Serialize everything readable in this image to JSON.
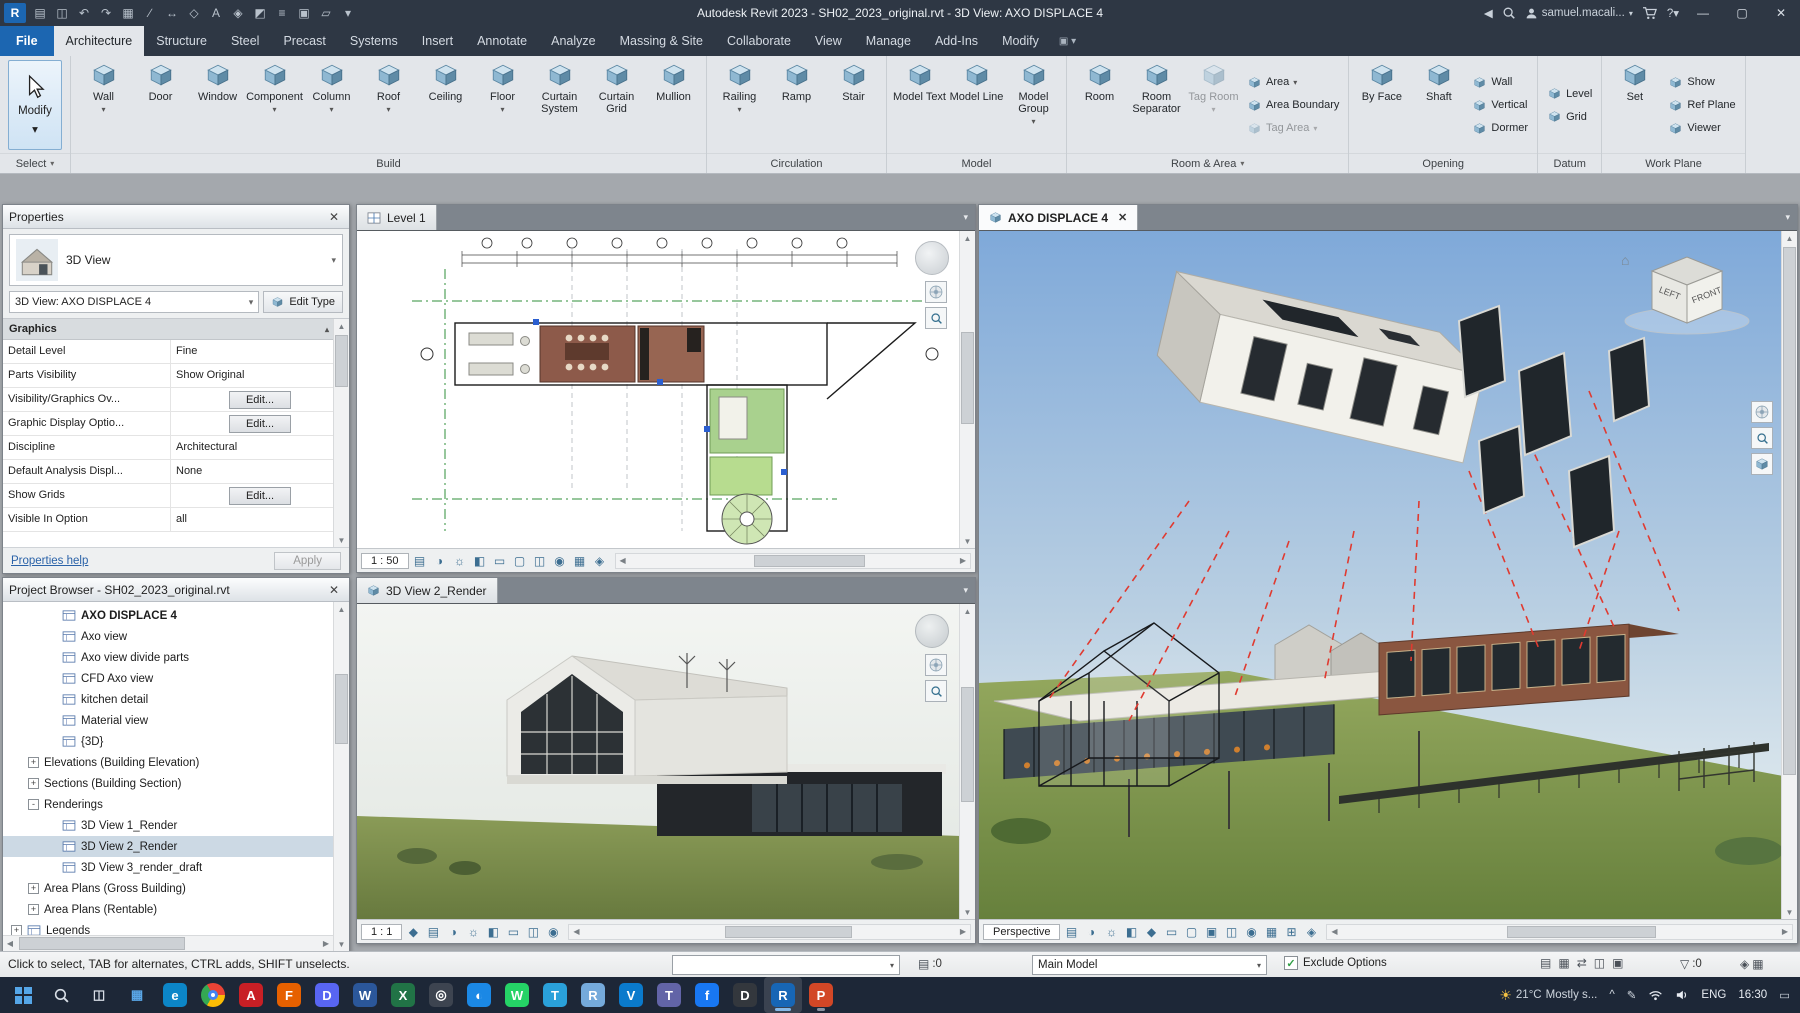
{
  "titlebar": {
    "title": "Autodesk Revit 2023 - SH02_2023_original.rvt - 3D View: AXO DISPLACE 4",
    "user_name": "samuel.macali...",
    "qat": [
      {
        "name": "revit-app-icon",
        "glyph": "R"
      },
      {
        "name": "open-icon",
        "glyph": "▤"
      },
      {
        "name": "save-icon",
        "glyph": "◫"
      },
      {
        "name": "undo-icon",
        "glyph": "↶"
      },
      {
        "name": "redo-icon",
        "glyph": "↷"
      },
      {
        "name": "print-icon",
        "glyph": "▦"
      },
      {
        "name": "measure-icon",
        "glyph": "∕"
      },
      {
        "name": "aligned-dimension-icon",
        "glyph": "↔"
      },
      {
        "name": "tag-by-category-icon",
        "glyph": "◇"
      },
      {
        "name": "text-icon",
        "glyph": "A"
      },
      {
        "name": "default-3d-view-icon",
        "glyph": "◈"
      },
      {
        "name": "section-icon",
        "glyph": "◩"
      },
      {
        "name": "thin-lines-icon",
        "glyph": "≡"
      },
      {
        "name": "close-hidden-windows-icon",
        "glyph": "▣"
      },
      {
        "name": "switch-windows-icon",
        "glyph": "▱"
      },
      {
        "name": "customize-qat-icon",
        "glyph": "▾"
      }
    ]
  },
  "ribbon": {
    "file_tab": "File",
    "tabs": [
      "Architecture",
      "Structure",
      "Steel",
      "Precast",
      "Systems",
      "Insert",
      "Annotate",
      "Analyze",
      "Massing & Site",
      "Collaborate",
      "View",
      "Manage",
      "Add-Ins",
      "Modify"
    ],
    "active_tab": "Architecture",
    "modify_button": "Modify",
    "panels": [
      {
        "label": "Select",
        "arrow": true,
        "groups": [
          {
            "type": "modify"
          }
        ]
      },
      {
        "label": "Build",
        "groups": [
          {
            "type": "big",
            "items": [
              {
                "label": "Wall",
                "arrow": true
              },
              {
                "label": "Door"
              },
              {
                "label": "Window"
              },
              {
                "label": "Component",
                "arrow": true
              },
              {
                "label": "Column",
                "arrow": true
              },
              {
                "label": "Roof",
                "arrow": true
              },
              {
                "label": "Ceiling"
              },
              {
                "label": "Floor",
                "arrow": true
              },
              {
                "label": "Curtain System"
              },
              {
                "label": "Curtain Grid"
              },
              {
                "label": "Mullion"
              }
            ]
          }
        ]
      },
      {
        "label": "Circulation",
        "groups": [
          {
            "type": "big",
            "items": [
              {
                "label": "Railing",
                "arrow": true
              },
              {
                "label": "Ramp"
              },
              {
                "label": "Stair"
              }
            ]
          }
        ]
      },
      {
        "label": "Model",
        "groups": [
          {
            "type": "big",
            "items": [
              {
                "label": "Model Text"
              },
              {
                "label": "Model Line"
              },
              {
                "label": "Model Group",
                "arrow": true
              }
            ]
          }
        ]
      },
      {
        "label": "Room & Area",
        "arrow": true,
        "groups": [
          {
            "type": "big",
            "items": [
              {
                "label": "Room"
              },
              {
                "label": "Room Separator"
              },
              {
                "label": "Tag Room",
                "arrow": true,
                "disabled": true
              }
            ]
          },
          {
            "type": "stack",
            "items": [
              {
                "label": "Area",
                "arrow": true
              },
              {
                "label": "Area Boundary"
              },
              {
                "label": "Tag Area",
                "arrow": true,
                "disabled": true
              }
            ]
          }
        ]
      },
      {
        "label": "Opening",
        "groups": [
          {
            "type": "big",
            "items": [
              {
                "label": "By Face"
              },
              {
                "label": "Shaft"
              }
            ]
          },
          {
            "type": "stack",
            "items": [
              {
                "label": "Wall"
              },
              {
                "label": "Vertical"
              },
              {
                "label": "Dormer"
              }
            ]
          }
        ]
      },
      {
        "label": "Datum",
        "groups": [
          {
            "type": "stack",
            "items": [
              {
                "label": "Level"
              },
              {
                "label": "Grid"
              }
            ]
          }
        ]
      },
      {
        "label": "Work Plane",
        "groups": [
          {
            "type": "big",
            "items": [
              {
                "label": "Set"
              }
            ]
          },
          {
            "type": "stack",
            "items": [
              {
                "label": "Show"
              },
              {
                "label": "Ref Plane"
              },
              {
                "label": "Viewer"
              }
            ]
          }
        ]
      }
    ]
  },
  "properties": {
    "title": "Properties",
    "type_label": "3D View",
    "instance_label": "3D View: AXO DISPLACE 4",
    "edit_type_label": "Edit Type",
    "section_label": "Graphics",
    "rows": [
      {
        "label": "Detail Level",
        "value": "Fine"
      },
      {
        "label": "Parts Visibility",
        "value": "Show Original"
      },
      {
        "label": "Visibility/Graphics Ov...",
        "value": "Edit...",
        "kind": "button"
      },
      {
        "label": "Graphic Display Optio...",
        "value": "Edit...",
        "kind": "button"
      },
      {
        "label": "Discipline",
        "value": "Architectural"
      },
      {
        "label": "Default Analysis Displ...",
        "value": "None"
      },
      {
        "label": "Show Grids",
        "value": "Edit...",
        "kind": "button"
      },
      {
        "label": "Visible In Option",
        "value": "all"
      }
    ],
    "help_label": "Properties help",
    "apply_label": "Apply"
  },
  "project_browser": {
    "title": "Project Browser - SH02_2023_original.rvt",
    "items": [
      {
        "label": "AXO DISPLACE 4",
        "indent": 3,
        "icon": true,
        "bold": true
      },
      {
        "label": "Axo view",
        "indent": 3,
        "icon": true
      },
      {
        "label": "Axo view divide parts",
        "indent": 3,
        "icon": true
      },
      {
        "label": "CFD Axo view",
        "indent": 3,
        "icon": true
      },
      {
        "label": "kitchen detail",
        "indent": 3,
        "icon": true
      },
      {
        "label": "Material view",
        "indent": 3,
        "icon": true
      },
      {
        "label": "{3D}",
        "indent": 3,
        "icon": true
      },
      {
        "label": "Elevations (Building Elevation)",
        "indent": 1,
        "expander": "+"
      },
      {
        "label": "Sections (Building Section)",
        "indent": 1,
        "expander": "+"
      },
      {
        "label": "Renderings",
        "indent": 1,
        "expander": "-"
      },
      {
        "label": "3D View 1_Render",
        "indent": 3,
        "icon": true
      },
      {
        "label": "3D View 2_Render",
        "indent": 3,
        "icon": true,
        "selected": true
      },
      {
        "label": "3D View 3_render_draft",
        "indent": 3,
        "icon": true
      },
      {
        "label": "Area Plans (Gross Building)",
        "indent": 1,
        "expander": "+"
      },
      {
        "label": "Area Plans (Rentable)",
        "indent": 1,
        "expander": "+"
      },
      {
        "label": "Legends",
        "indent": 0,
        "expander": "+",
        "icon": true
      }
    ]
  },
  "views": {
    "level1": {
      "tab": "Level 1",
      "scale": "1 : 50",
      "controls": [
        {
          "name": "detail-level-icon",
          "glyph": "▤"
        },
        {
          "name": "visual-style-icon",
          "glyph": "◑"
        },
        {
          "name": "sun-path-icon",
          "glyph": "☼"
        },
        {
          "name": "shadows-icon",
          "glyph": "◧"
        },
        {
          "name": "crop-view-icon",
          "glyph": "▭"
        },
        {
          "name": "show-crop-region-icon",
          "glyph": "▢"
        },
        {
          "name": "temporary-hide-isolate-icon",
          "glyph": "◫"
        },
        {
          "name": "reveal-hidden-elements-icon",
          "glyph": "◉"
        },
        {
          "name": "temporary-view-properties-icon",
          "glyph": "▦"
        },
        {
          "name": "show-constraints-icon",
          "glyph": "◈"
        }
      ]
    },
    "render": {
      "tab": "3D View 2_Render",
      "scale": "1 : 1",
      "controls": [
        {
          "name": "show-rendering-dialog-icon",
          "glyph": "◆"
        },
        {
          "name": "detail-level-icon",
          "glyph": "▤"
        },
        {
          "name": "visual-style-icon",
          "glyph": "◑"
        },
        {
          "name": "sun-path-icon",
          "glyph": "☼"
        },
        {
          "name": "shadows-icon",
          "glyph": "◧"
        },
        {
          "name": "crop-view-icon",
          "glyph": "▭"
        },
        {
          "name": "temporary-hide-isolate-icon",
          "glyph": "◫"
        },
        {
          "name": "reveal-hidden-elements-icon",
          "glyph": "◉"
        }
      ]
    },
    "axo": {
      "tab": "AXO DISPLACE 4",
      "scale": "Perspective",
      "viewcube": {
        "left": "LEFT",
        "front": "FRONT"
      },
      "controls": [
        {
          "name": "detail-level-icon",
          "glyph": "▤"
        },
        {
          "name": "visual-style-icon",
          "glyph": "◑"
        },
        {
          "name": "sun-path-icon",
          "glyph": "☼"
        },
        {
          "name": "shadows-icon",
          "glyph": "◧"
        },
        {
          "name": "show-rendering-dialog-icon",
          "glyph": "◆"
        },
        {
          "name": "crop-view-icon",
          "glyph": "▭"
        },
        {
          "name": "show-crop-region-icon",
          "glyph": "▢"
        },
        {
          "name": "lock-3d-view-icon",
          "glyph": "▣"
        },
        {
          "name": "temporary-hide-isolate-icon",
          "glyph": "◫"
        },
        {
          "name": "reveal-hidden-elements-icon",
          "glyph": "◉"
        },
        {
          "name": "temporary-view-properties-icon",
          "glyph": "▦"
        },
        {
          "name": "displace-elements-icon",
          "glyph": "⊞"
        },
        {
          "name": "reveal-constraints-icon",
          "glyph": "◈"
        }
      ]
    }
  },
  "status_bar": {
    "hint": "Click to select, TAB for alternates, CTRL adds, SHIFT unselects.",
    "workset_value": "",
    "editable_count": ":0",
    "design_option": "Main Model",
    "exclude_options": "Exclude Options",
    "filter_count": ":0",
    "right_icons": [
      {
        "name": "worksharing-display-icon",
        "glyph": "▤"
      },
      {
        "name": "performance-icon",
        "glyph": "▦"
      },
      {
        "name": "sync-icon",
        "glyph": "⇄"
      },
      {
        "name": "background-processes-icon",
        "glyph": "◫"
      },
      {
        "name": "select-toggle-icon",
        "glyph": "▣"
      }
    ]
  },
  "taskbar": {
    "icons": [
      {
        "name": "start-button",
        "special": "start"
      },
      {
        "name": "search-button",
        "special": "search"
      },
      {
        "name": "task-view-button",
        "glyph": "◫",
        "fg": "#d7dde6",
        "bg": "none"
      },
      {
        "name": "widgets-button",
        "glyph": "▦",
        "fg": "#5aa7e8",
        "bg": "none"
      },
      {
        "name": "edge-icon",
        "glyph": "e",
        "fg": "#fff",
        "bg": "#0c86c8"
      },
      {
        "name": "chrome-icon",
        "special": "chrome"
      },
      {
        "name": "acrobat-icon",
        "glyph": "A",
        "fg": "#fff",
        "bg": "#c81f25"
      },
      {
        "name": "firefox-icon",
        "glyph": "F",
        "fg": "#fff",
        "bg": "#e66000"
      },
      {
        "name": "discord-icon",
        "glyph": "D",
        "fg": "#fff",
        "bg": "#5865f2"
      },
      {
        "name": "word-icon",
        "glyph": "W",
        "fg": "#fff",
        "bg": "#2b579a"
      },
      {
        "name": "excel-icon",
        "glyph": "X",
        "fg": "#fff",
        "bg": "#217346"
      },
      {
        "name": "camera-icon",
        "glyph": "◎",
        "fg": "#fff",
        "bg": "#3d4450"
      },
      {
        "name": "safari-icon",
        "glyph": "◐",
        "fg": "#fff",
        "bg": "#1b88e5"
      },
      {
        "name": "whatsapp-icon",
        "glyph": "W",
        "fg": "#fff",
        "bg": "#25d366"
      },
      {
        "name": "telegram-icon",
        "glyph": "T",
        "fg": "#fff",
        "bg": "#2aa1da"
      },
      {
        "name": "rstudio-icon",
        "glyph": "R",
        "fg": "#fff",
        "bg": "#75aadb"
      },
      {
        "name": "vscode-icon",
        "glyph": "V",
        "fg": "#fff",
        "bg": "#0a7acc"
      },
      {
        "name": "teams-icon",
        "glyph": "T",
        "fg": "#fff",
        "bg": "#6264a7"
      },
      {
        "name": "facebook-icon",
        "glyph": "f",
        "fg": "#fff",
        "bg": "#1877f2"
      },
      {
        "name": "dynamo-icon",
        "glyph": "D",
        "fg": "#fff",
        "bg": "#33373d"
      },
      {
        "name": "revit-icon",
        "glyph": "R",
        "fg": "#fff",
        "bg": "#1766b5",
        "active": true
      },
      {
        "name": "powerpoint-icon",
        "glyph": "P",
        "fg": "#fff",
        "bg": "#d24726",
        "running": true
      }
    ],
    "weather_temp": "21°C",
    "weather_desc": "Mostly s...",
    "language": "ENG",
    "time": "16:30"
  }
}
